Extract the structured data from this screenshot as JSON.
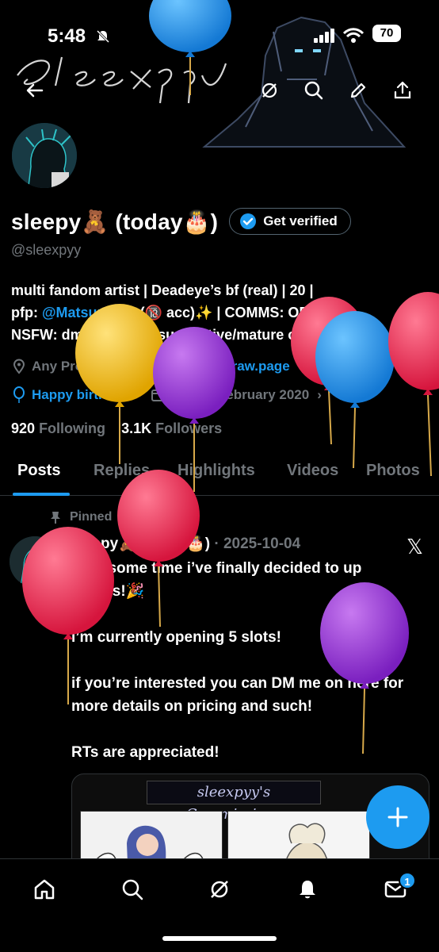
{
  "status_bar": {
    "time": "5:48",
    "battery": "70"
  },
  "banner": {
    "signature": "sleexpyy"
  },
  "profile": {
    "display_name": "sleepy🧸 (today🎂)",
    "verify_label": "Get verified",
    "handle": "@sleexpyy",
    "bio_line1": "multi fandom artist | Deadeye’s bf (real) | 20 |",
    "bio_line2_prefix": "pfp: ",
    "bio_line2_link": "@MatsuraONI",
    "bio_line2_suffix": " (🔞 acc)✨ | COMMS: OPEN |",
    "bio_line3": "NSFW: dm me ! | 📕 | suggestive/mature content!",
    "pronouns": "Any Pronouns",
    "website": "sleexpyy.straw.page",
    "birthday": "Happy birthday!",
    "joined": "Joined February 2020",
    "following_count": "920",
    "following_label": "Following",
    "followers_count": "3.1K",
    "followers_label": "Followers"
  },
  "tabs": [
    "Posts",
    "Replies",
    "Highlights",
    "Videos",
    "Photos"
  ],
  "post": {
    "pinned_label": "Pinned",
    "author": "sleepy🧸 (today🎂)",
    "date": "· 2025-10-04",
    "line1": "after some time i’ve finally decided to up",
    "line2": "c*mms!🎉",
    "para2": "i’m currently opening 5 slots!",
    "para3": "if you’re interested you can DM me on here for more details on pricing and such!",
    "para4": "RTs are appreciated!",
    "media_title": "sleexpyy's Commissions"
  },
  "bottom_nav": {
    "messages_badge": "1"
  },
  "icons": [
    "back-icon",
    "grok-icon",
    "search-icon",
    "edit-icon",
    "share-icon",
    "location-icon",
    "link-icon",
    "balloon-icon",
    "calendar-icon",
    "pin-icon",
    "plus-icon",
    "home-icon",
    "notifications-icon",
    "messages-icon"
  ],
  "colors": {
    "accent": "#1d9bf0",
    "text": "#e7e9ea",
    "muted": "#71767b",
    "border": "#2f3336",
    "background": "#000000"
  }
}
